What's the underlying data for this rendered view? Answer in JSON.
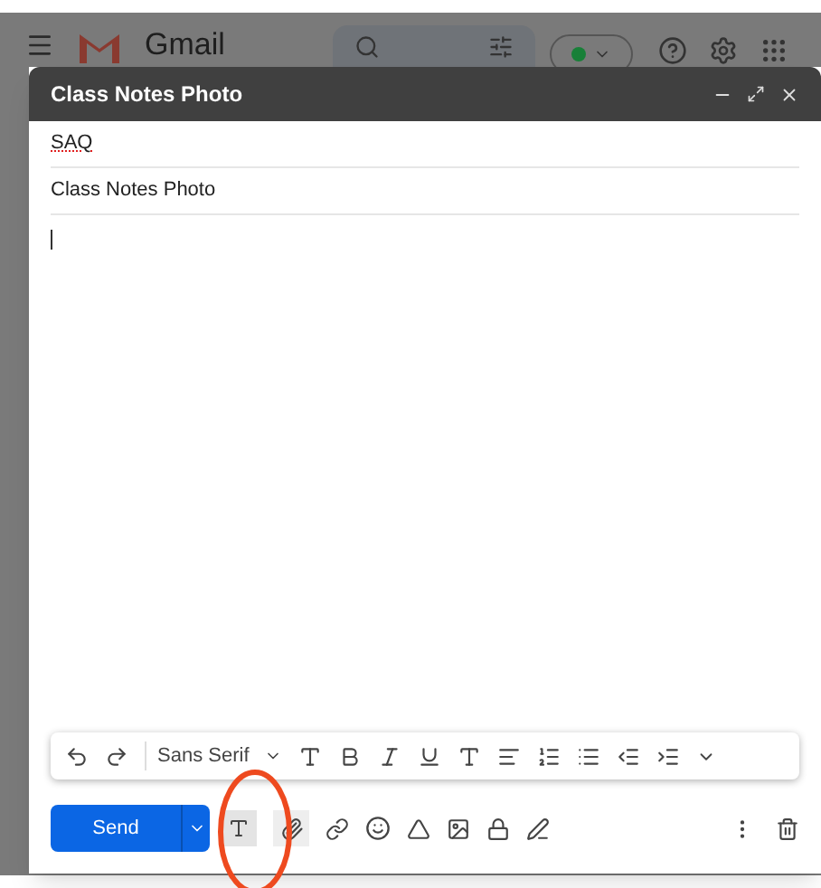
{
  "app_header": {
    "logo_text": "Gmail",
    "status": {
      "color": "#188038"
    }
  },
  "compose": {
    "title": "Class Notes Photo",
    "to": {
      "value": "SAQ",
      "misspelled": true
    },
    "subject": "Class Notes Photo",
    "formatting_toolbar": {
      "font": "Sans Serif"
    },
    "send_label": "Send",
    "attach_highlighted": true
  }
}
